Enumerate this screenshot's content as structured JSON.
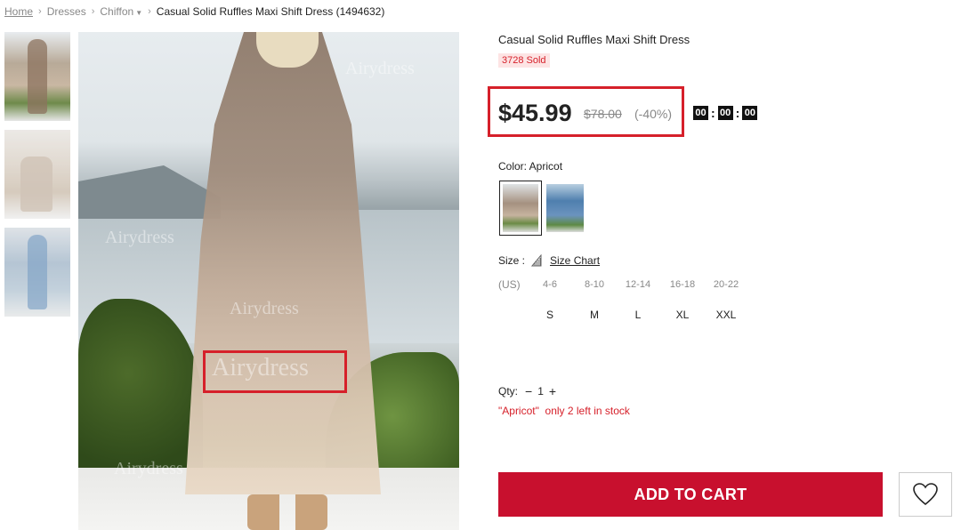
{
  "breadcrumb": {
    "home": "Home",
    "dresses": "Dresses",
    "chiffon": "Chiffon",
    "current": "Casual Solid Ruffles Maxi Shift Dress (1494632)"
  },
  "gallery": {
    "watermark": "Airydress"
  },
  "product": {
    "title": "Casual Solid Ruffles Maxi Shift Dress",
    "sold": "3728 Sold",
    "price_current": "$45.99",
    "price_original": "$78.00",
    "discount": "(-40%)",
    "countdown": {
      "hours": "00",
      "minutes": "00",
      "seconds": "00"
    },
    "color_label": "Color: Apricot",
    "size_label": "Size :",
    "size_chart_label": "Size Chart",
    "us_label": "(US)",
    "us_sizes": [
      "4-6",
      "8-10",
      "12-14",
      "16-18",
      "20-22"
    ],
    "sizes": [
      "S",
      "M",
      "L",
      "XL",
      "XXL"
    ],
    "qty_label": "Qty:",
    "qty_value": "1",
    "qty_minus": "−",
    "qty_plus": "+",
    "stock_message": "\"Apricot\"  only 2 left in stock",
    "add_to_cart": "ADD TO CART"
  },
  "colors": {
    "accent": "#c8102e",
    "highlight": "#d6202a"
  }
}
